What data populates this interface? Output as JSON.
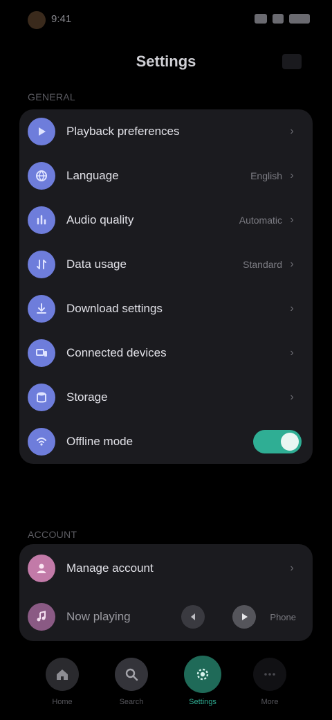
{
  "status_bar": {
    "time": "9:41"
  },
  "header": {
    "title": "Settings"
  },
  "sections": {
    "general": {
      "label": "GENERAL",
      "icon_color": "#6e7ddb",
      "items": [
        {
          "label": "Playback preferences",
          "value": "",
          "icon": "play-icon",
          "type": "link"
        },
        {
          "label": "Language",
          "value": "English",
          "icon": "globe-icon",
          "type": "link"
        },
        {
          "label": "Audio quality",
          "value": "Automatic",
          "icon": "equalizer-icon",
          "type": "link"
        },
        {
          "label": "Data usage",
          "value": "Standard",
          "icon": "data-icon",
          "type": "link"
        },
        {
          "label": "Download settings",
          "value": "",
          "icon": "download-icon",
          "type": "link"
        },
        {
          "label": "Connected devices",
          "value": "",
          "icon": "devices-icon",
          "type": "link"
        },
        {
          "label": "Storage",
          "value": "",
          "icon": "storage-icon",
          "type": "link"
        },
        {
          "label": "Offline mode",
          "value": "",
          "icon": "offline-icon",
          "type": "toggle",
          "on": true
        }
      ]
    },
    "account": {
      "label": "ACCOUNT",
      "icon_color": "#c27aa8",
      "item": {
        "label": "Manage account",
        "icon": "user-icon"
      }
    }
  },
  "mini_player": {
    "title": "Now playing",
    "device": "Phone",
    "icon_color": "#8a5a84"
  },
  "bottom_nav": {
    "accent": "#2fae94",
    "items": [
      {
        "label": "Home",
        "icon": "home-icon"
      },
      {
        "label": "Search",
        "icon": "search-icon"
      },
      {
        "label": "Settings",
        "icon": "gear-icon",
        "active": true
      },
      {
        "label": "More",
        "icon": "more-icon"
      }
    ]
  }
}
